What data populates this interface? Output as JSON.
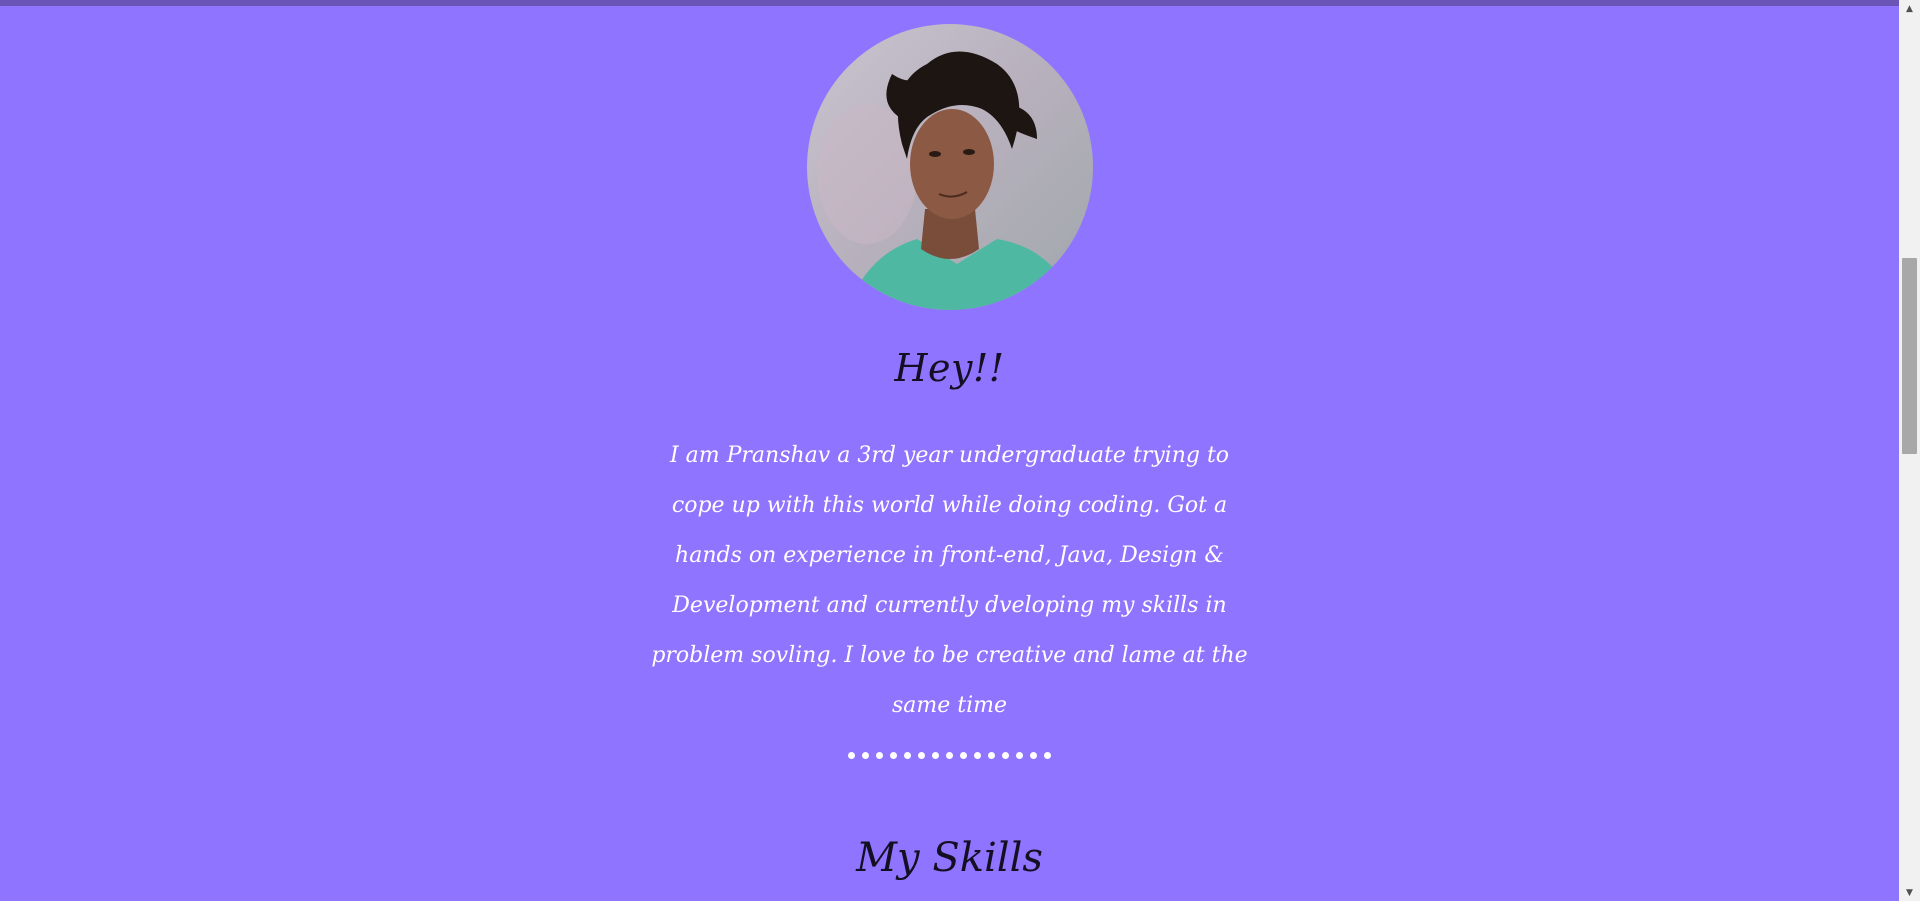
{
  "about": {
    "greeting": "Hey!!",
    "bio": "I am Pranshav a 3rd year undergraduate trying to cope up with this world while doing coding. Got a hands on experience in front-end, Java, Design & Development and currently dveloping my skills in problem sovling. I love to be creative and lame at the same time",
    "avatar_icon": "profile-photo"
  },
  "divider": {
    "dot_count": 15
  },
  "skills": {
    "heading": "My Skills"
  },
  "scrollbar": {
    "up_icon": "arrow-up-icon",
    "down_icon": "arrow-down-icon"
  },
  "colors": {
    "background": "#8f74ff",
    "heading_text": "#141024",
    "body_text": "#ffffff",
    "top_strip": "#6a55b7"
  }
}
